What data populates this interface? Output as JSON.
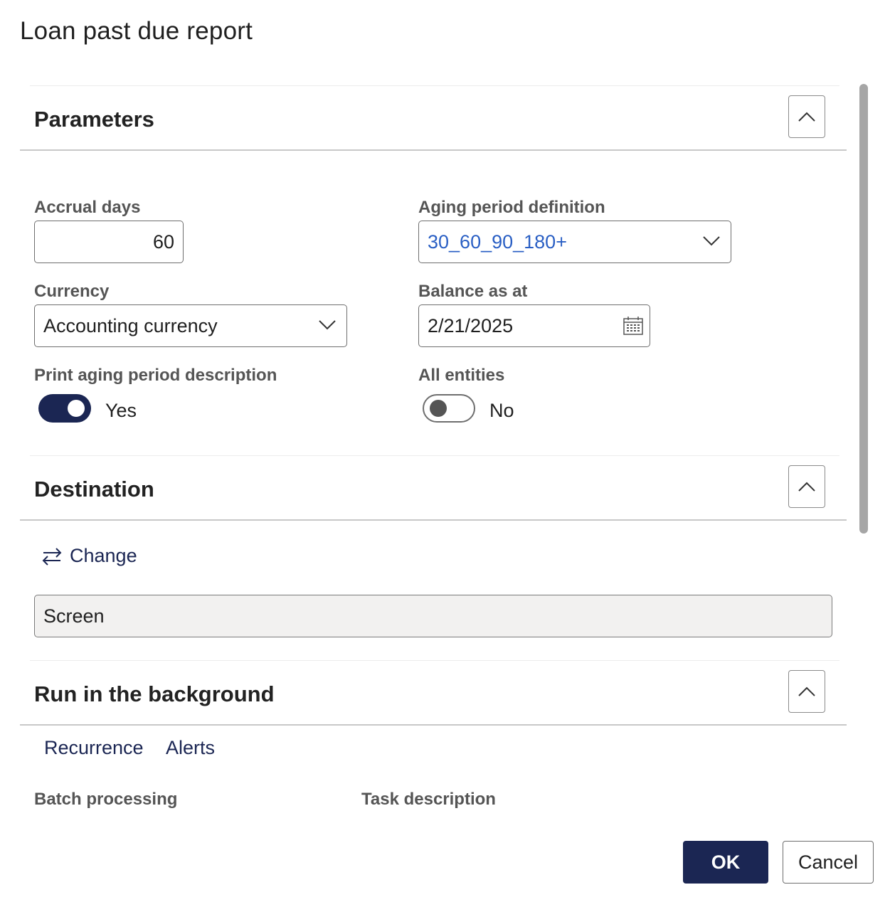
{
  "dialog": {
    "title": "Loan past due report"
  },
  "sections": {
    "parameters": {
      "title": "Parameters"
    },
    "destination": {
      "title": "Destination"
    },
    "background": {
      "title": "Run in the background"
    }
  },
  "parameters": {
    "accrual_days": {
      "label": "Accrual days",
      "value": "60"
    },
    "aging_period": {
      "label": "Aging period definition",
      "value": "30_60_90_180+"
    },
    "currency": {
      "label": "Currency",
      "value": "Accounting currency"
    },
    "balance_as_at": {
      "label": "Balance as at",
      "value": "2/21/2025"
    },
    "print_aging_desc": {
      "label": "Print aging period description",
      "state": "Yes",
      "on": true
    },
    "all_entities": {
      "label": "All entities",
      "state": "No",
      "on": false
    }
  },
  "destination": {
    "change_label": "Change",
    "value": "Screen"
  },
  "background": {
    "tabs": [
      "Recurrence",
      "Alerts"
    ],
    "batch_label": "Batch processing",
    "task_label": "Task description"
  },
  "footer": {
    "ok_label": "OK",
    "cancel_label": "Cancel"
  },
  "colors": {
    "accent": "#1b2653",
    "link": "#2a5fc4"
  }
}
